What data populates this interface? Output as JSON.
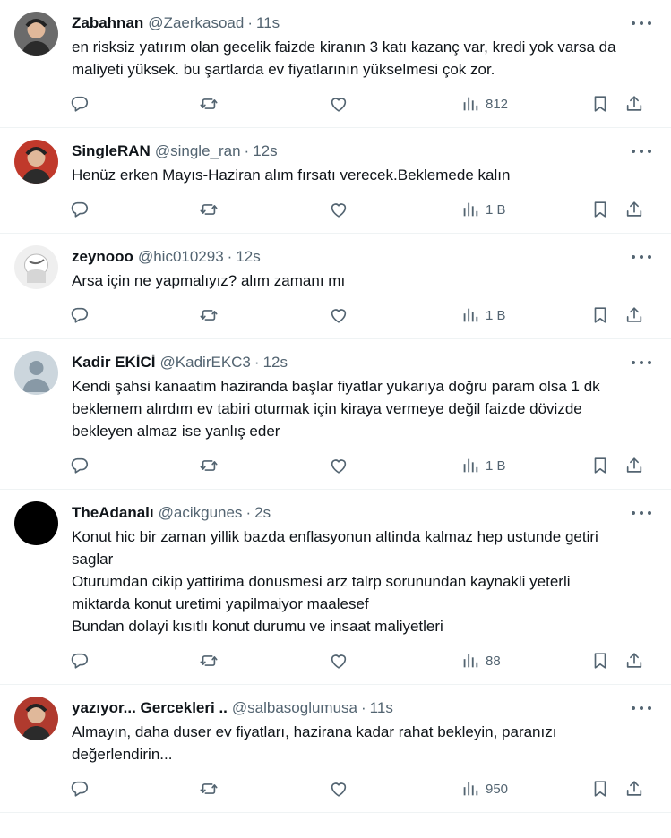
{
  "tweets": [
    {
      "name": "Zabahnan",
      "handle": "@Zaerkasoad",
      "dot": "·",
      "time": "11s",
      "lines": [
        "en risksiz yatırım olan gecelik faizde kiranın 3 katı kazanç var, kredi yok varsa da maliyeti yüksek. bu şartlarda ev fiyatlarının yükselmesi çok zor."
      ],
      "views": "812",
      "avatar_color": "#6b6b6b"
    },
    {
      "name": "SingleRAN",
      "handle": "@single_ran",
      "dot": "·",
      "time": "12s",
      "lines": [
        "Henüz erken Mayıs-Haziran alım fırsatı verecek.Beklemede kalın"
      ],
      "views": "1 B",
      "avatar_color": "#c0392b"
    },
    {
      "name": "zeynooo",
      "handle": "@hic010293",
      "dot": "·",
      "time": "12s",
      "lines": [
        "Arsa için ne yapmalıyız? alım zamanı mı"
      ],
      "views": "1 B",
      "avatar_color": "#d9d9d9"
    },
    {
      "name": "Kadir EKİCİ",
      "handle": "@KadirEKC3",
      "dot": "·",
      "time": "12s",
      "lines": [
        "Kendi şahsi kanaatim haziranda başlar fiyatlar yukarıya doğru param olsa 1 dk beklemem alırdım ev tabiri oturmak için kiraya vermeye değil faizde dövizde bekleyen almaz ise yanlış eder"
      ],
      "views": "1 B",
      "avatar_color": "#ccd6dd"
    },
    {
      "name": "TheAdanalı",
      "handle": "@acikgunes",
      "dot": "·",
      "time": "2s",
      "lines": [
        "Konut hic bir zaman yillik bazda enflasyonun altinda kalmaz hep ustunde getiri saglar",
        "Oturumdan cikip yattirima donusmesi arz talrp sorunundan kaynakli yeterli miktarda konut uretimi yapilmaiyor maalesef",
        "Bundan dolayi kısıtlı konut durumu ve insaat maliyetleri"
      ],
      "views": "88",
      "avatar_color": "#000000"
    },
    {
      "name": "yazıyor... Gercekleri ..",
      "handle": "@salbasoglumusa",
      "dot": "·",
      "time": "11s",
      "lines": [
        "Almayın, daha duser ev fiyatları, hazirana kadar rahat bekleyin, paranızı değerlendirin..."
      ],
      "views": "950",
      "avatar_color": "#b03a2e"
    }
  ]
}
